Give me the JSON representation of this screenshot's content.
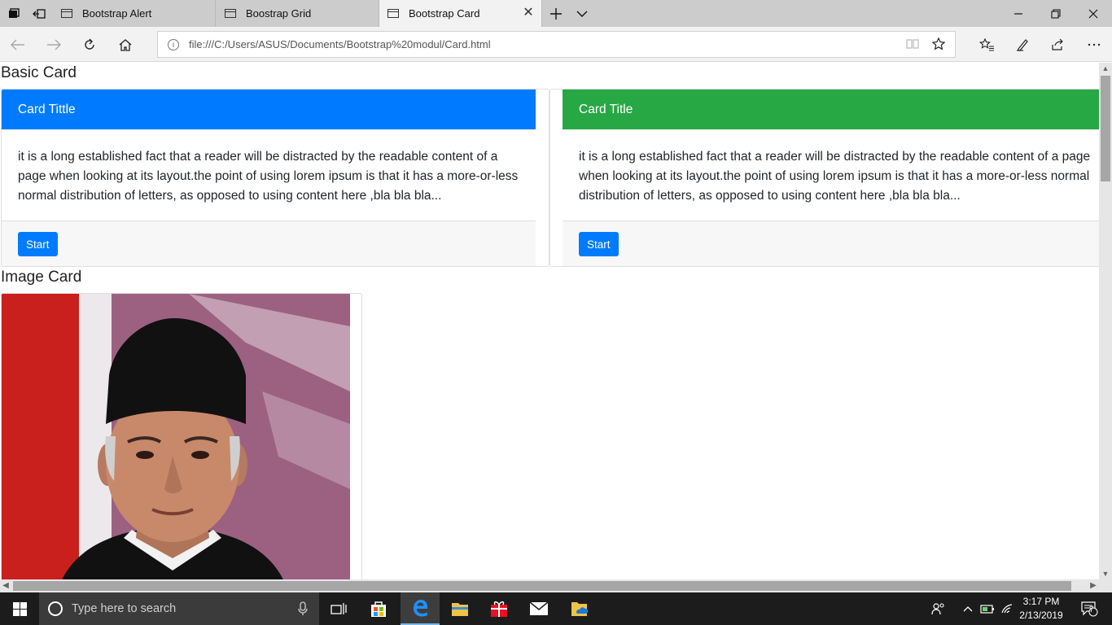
{
  "browser": {
    "tabs": [
      {
        "label": "Bootstrap Alert",
        "active": false
      },
      {
        "label": "Boostrap Grid",
        "active": false
      },
      {
        "label": "Bootstrap Card",
        "active": true
      }
    ],
    "address": "file:///C:/Users/ASUS/Documents/Bootstrap%20modul/Card.html"
  },
  "page": {
    "basic_card_heading": "Basic Card",
    "cards": [
      {
        "title": "Card Tittle",
        "header_color": "#007bff",
        "body": "it is a long established fact that a reader will be distracted by the readable content of a page when looking at its layout.the point of using lorem ipsum is that it has a more-or-less normal distribution of letters, as opposed to using content here ,bla bla bla...",
        "button": "Start"
      },
      {
        "title": "Card Title",
        "header_color": "#28a745",
        "body": "it is a long established fact that a reader will be distracted by the readable content of a page when looking at its layout.the point of using lorem ipsum is that it has a more-or-less normal distribution of letters, as opposed to using content here ,bla bla bla...",
        "button": "Start"
      }
    ],
    "image_card_heading": "Image Card"
  },
  "taskbar": {
    "search_placeholder": "Type here to search",
    "time": "3:17 PM",
    "date": "2/13/2019",
    "notification_count": "7"
  }
}
